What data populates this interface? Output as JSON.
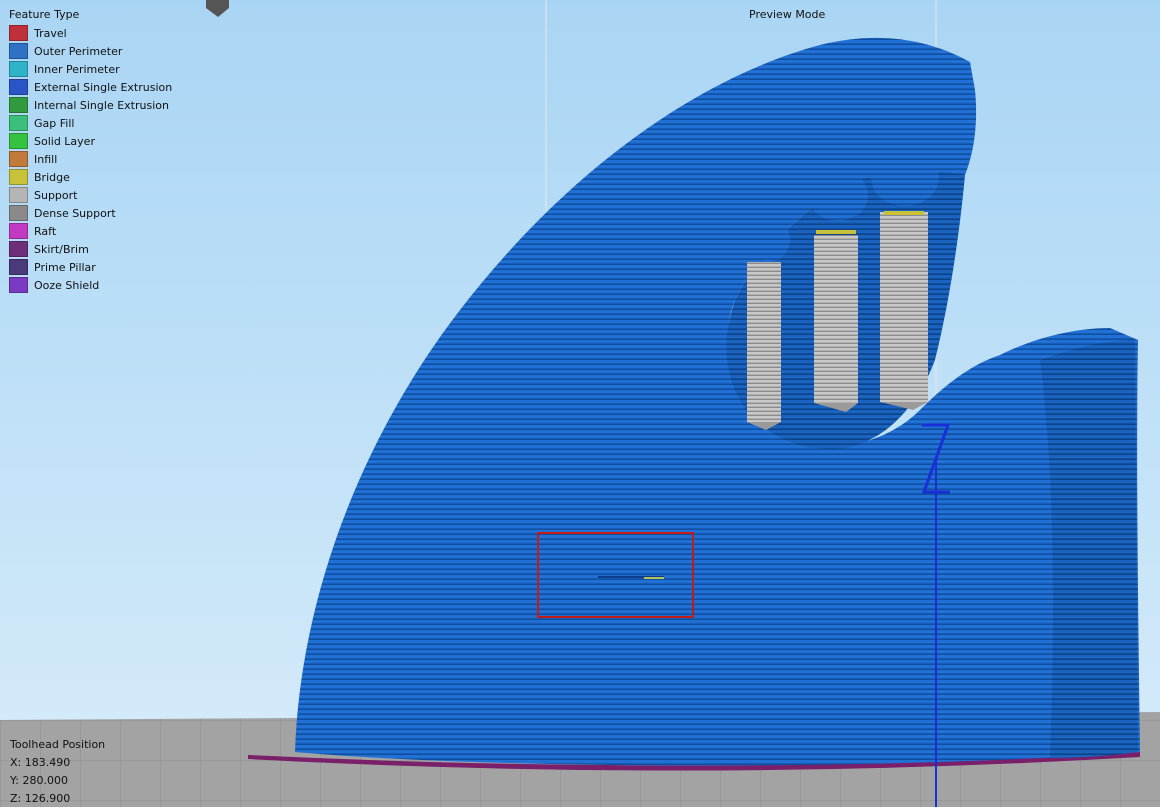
{
  "legend": {
    "title": "Feature Type",
    "items": [
      {
        "label": "Travel",
        "color": "#c0303a"
      },
      {
        "label": "Outer Perimeter",
        "color": "#2f72c4"
      },
      {
        "label": "Inner Perimeter",
        "color": "#2eb3c9"
      },
      {
        "label": "External Single Extrusion",
        "color": "#2a55c7"
      },
      {
        "label": "Internal Single Extrusion",
        "color": "#2f9a3e"
      },
      {
        "label": "Gap Fill",
        "color": "#3bbf7a"
      },
      {
        "label": "Solid Layer",
        "color": "#35c240"
      },
      {
        "label": "Infill",
        "color": "#c07a3a"
      },
      {
        "label": "Bridge",
        "color": "#c7c23a"
      },
      {
        "label": "Support",
        "color": "#b5b5b5"
      },
      {
        "label": "Dense Support",
        "color": "#8a8a8a"
      },
      {
        "label": "Raft",
        "color": "#c23ac2"
      },
      {
        "label": "Skirt/Brim",
        "color": "#6e2e7a"
      },
      {
        "label": "Prime Pillar",
        "color": "#4a3a7a"
      },
      {
        "label": "Ooze Shield",
        "color": "#7a3ac2"
      }
    ]
  },
  "mode_label": "Preview Mode",
  "toolhead": {
    "title": "Toolhead Position",
    "x": "X: 183.490",
    "y": "Y: 280.000",
    "z": "Z: 126.900"
  },
  "axis_label": "Z",
  "colors": {
    "model": "#1f6fd1",
    "support": "#bdbdbd",
    "brim": "#7a1f6a",
    "bed": "#9c9c9c"
  }
}
